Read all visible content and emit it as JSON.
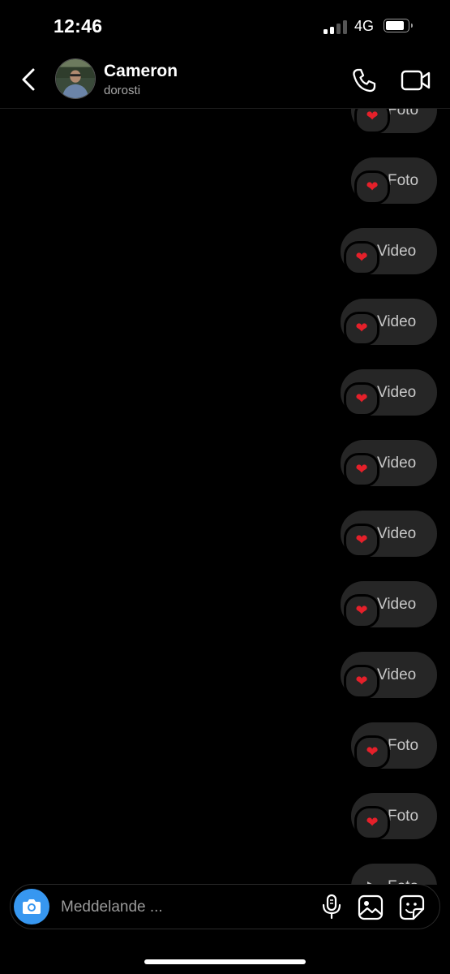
{
  "status_bar": {
    "time": "12:46",
    "network": "4G"
  },
  "header": {
    "name": "Cameron",
    "username": "dorosti"
  },
  "messages": [
    {
      "type": "photo",
      "label": "Foto",
      "reaction": "heart"
    },
    {
      "type": "photo",
      "label": "Foto",
      "reaction": "heart"
    },
    {
      "type": "video",
      "label": "Video",
      "reaction": "heart"
    },
    {
      "type": "video",
      "label": "Video",
      "reaction": "heart"
    },
    {
      "type": "video",
      "label": "Video",
      "reaction": "heart"
    },
    {
      "type": "video",
      "label": "Video",
      "reaction": "heart"
    },
    {
      "type": "video",
      "label": "Video",
      "reaction": "heart"
    },
    {
      "type": "video",
      "label": "Video",
      "reaction": "heart"
    },
    {
      "type": "video",
      "label": "Video",
      "reaction": "heart"
    },
    {
      "type": "photo",
      "label": "Foto",
      "reaction": "heart"
    },
    {
      "type": "photo",
      "label": "Foto",
      "reaction": "heart"
    },
    {
      "type": "photo",
      "label": "Foto",
      "reaction": null
    }
  ],
  "composer": {
    "placeholder": "Meddelande ...",
    "value": ""
  },
  "icons": {
    "back": "chevron-left-icon",
    "call": "phone-icon",
    "video_call": "video-camera-icon",
    "camera": "camera-icon",
    "mic": "microphone-icon",
    "gallery": "image-icon",
    "sticker": "sticker-icon",
    "reaction": "heart-icon"
  },
  "colors": {
    "accent": "#3797f0",
    "bubble": "#262626",
    "heart": "#e5202a",
    "background": "#000000"
  }
}
